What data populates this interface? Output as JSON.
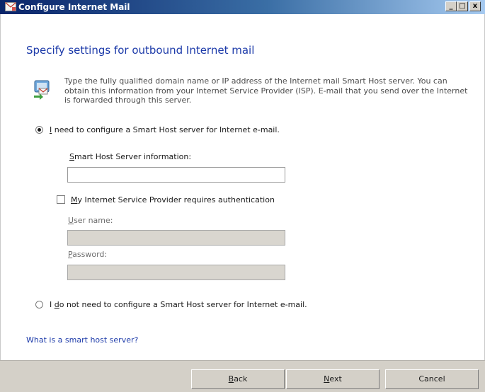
{
  "window": {
    "title": "Configure Internet Mail",
    "controls": {
      "minimize": "_",
      "maximize": "□",
      "close": "x"
    }
  },
  "main": {
    "heading": "Specify settings for outbound Internet mail",
    "description": "Type the fully qualified domain name or IP address of the Internet mail Smart Host server. You can obtain this information from your Internet Service Provider (ISP). E-mail that you send over the Internet is forwarded through this server.",
    "option1": {
      "prefix": "",
      "mnemonic": "I",
      "rest": " need to configure a Smart Host server for Internet e-mail.",
      "selected": true
    },
    "smart_host_label": {
      "mnemonic": "S",
      "rest": "mart Host Server information:"
    },
    "smart_host_value": "",
    "auth_checkbox": {
      "mnemonic": "M",
      "rest": "y Internet Service Provider requires authentication",
      "checked": false
    },
    "username_label": {
      "mnemonic": "U",
      "rest": "ser name:"
    },
    "username_value": "",
    "password_label": {
      "mnemonic": "P",
      "rest": "assword:"
    },
    "password_value": "",
    "option2": {
      "prefix": "I ",
      "mnemonic": "d",
      "rest": "o not need to configure a Smart Host server for Internet e-mail.",
      "selected": false
    },
    "help_link": "What is a smart host server?"
  },
  "footer": {
    "back": {
      "mnemonic": "B",
      "rest": "ack"
    },
    "next": {
      "mnemonic": "N",
      "rest": "ext"
    },
    "cancel": "Cancel"
  }
}
